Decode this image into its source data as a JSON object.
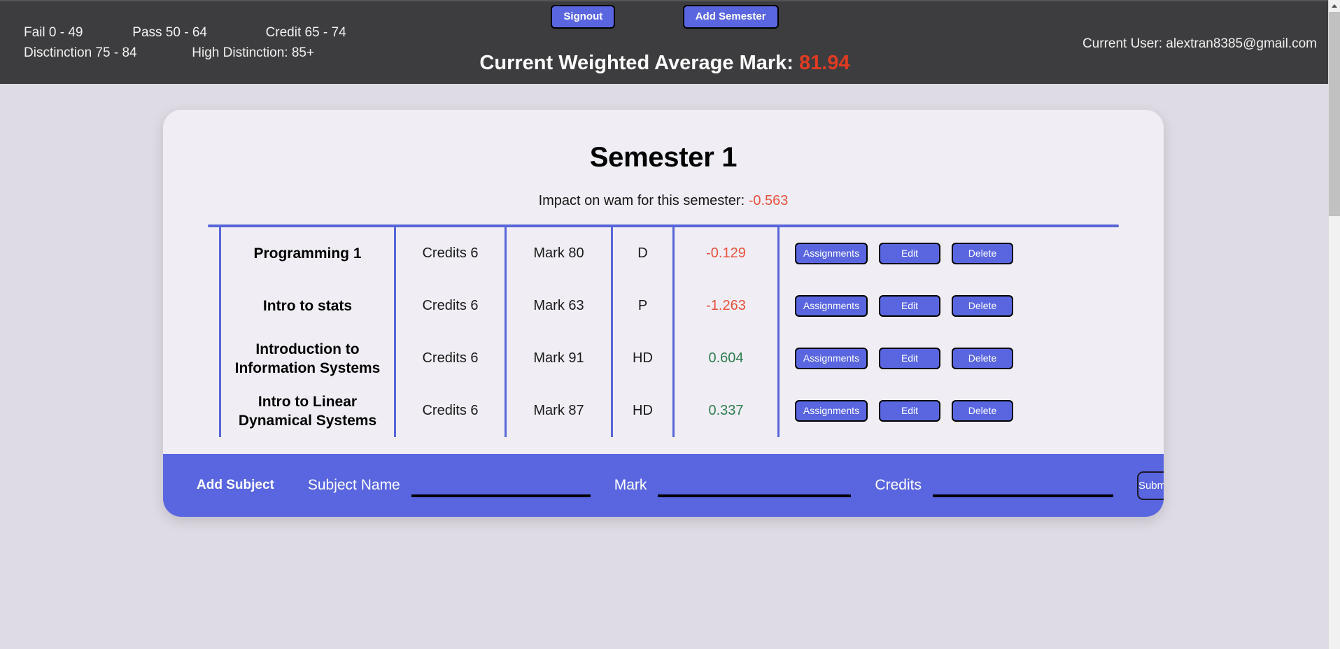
{
  "header": {
    "grading_scale": [
      "Fail 0 - 49",
      "Pass 50 - 64",
      "Credit 65 - 74",
      "Disctinction 75 - 84",
      "High Distinction: 85+"
    ],
    "signout_label": "Signout",
    "add_semester_label": "Add Semester",
    "wam_label": "Current Weighted Average Mark:",
    "wam_value": "81.94",
    "wam_value_color": "#e03b22",
    "current_user_label": "Current User: alextran8385@gmail.com"
  },
  "semester": {
    "title": "Semester 1",
    "impact_label": "Impact on wam for this semester:",
    "impact_value": "-0.563",
    "impact_sign": "negative",
    "subjects": [
      {
        "name": "Programming 1",
        "credits": "Credits 6",
        "mark": "Mark 80",
        "grade": "D",
        "impact": "-0.129",
        "impact_sign": "negative",
        "assignments_label": "Assignments",
        "edit_label": "Edit",
        "delete_label": "Delete"
      },
      {
        "name": "Intro to stats",
        "credits": "Credits 6",
        "mark": "Mark 63",
        "grade": "P",
        "impact": "-1.263",
        "impact_sign": "negative",
        "assignments_label": "Assignments",
        "edit_label": "Edit",
        "delete_label": "Delete"
      },
      {
        "name": "Introduction to Information Systems",
        "credits": "Credits 6",
        "mark": "Mark 91",
        "grade": "HD",
        "impact": "0.604",
        "impact_sign": "positive",
        "assignments_label": "Assignments",
        "edit_label": "Edit",
        "delete_label": "Delete"
      },
      {
        "name": "Intro to Linear Dynamical Systems",
        "credits": "Credits 6",
        "mark": "Mark 87",
        "grade": "HD",
        "impact": "0.337",
        "impact_sign": "positive",
        "assignments_label": "Assignments",
        "edit_label": "Edit",
        "delete_label": "Delete"
      }
    ]
  },
  "add_subject_form": {
    "title": "Add Subject",
    "subject_name_label": "Subject Name",
    "subject_name_value": "",
    "subject_name_placeholder": "",
    "mark_label": "Mark",
    "mark_value": "",
    "mark_placeholder": "",
    "credits_label": "Credits",
    "credits_value": "",
    "credits_placeholder": "",
    "submit_label": "Submit"
  },
  "colors": {
    "accent_blue": "#5a66e0",
    "page_background": "#dfdbe5",
    "card_background": "#f0eef4",
    "topbar_background": "#3d3d3f",
    "negative": "#e8513f",
    "positive": "#2e7d4f"
  }
}
